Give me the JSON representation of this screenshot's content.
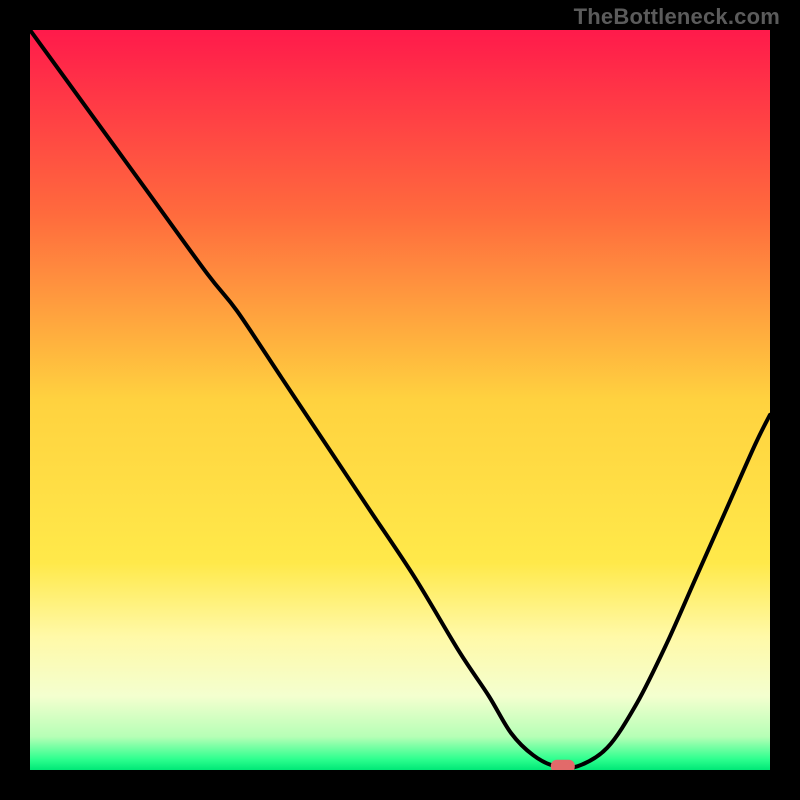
{
  "watermark": "TheBottleneck.com",
  "chart_data": {
    "type": "line",
    "title": "",
    "xlabel": "",
    "ylabel": "",
    "xlim": [
      0,
      100
    ],
    "ylim": [
      0,
      100
    ],
    "grid": false,
    "legend": false,
    "background_gradient": {
      "stops": [
        {
          "pos": 0.0,
          "color": "#ff1a4b"
        },
        {
          "pos": 0.25,
          "color": "#ff6b3d"
        },
        {
          "pos": 0.5,
          "color": "#ffd23f"
        },
        {
          "pos": 0.72,
          "color": "#ffe94a"
        },
        {
          "pos": 0.82,
          "color": "#fff9a8"
        },
        {
          "pos": 0.9,
          "color": "#f4ffcf"
        },
        {
          "pos": 0.955,
          "color": "#b6ffb6"
        },
        {
          "pos": 0.985,
          "color": "#2fff8f"
        },
        {
          "pos": 1.0,
          "color": "#00e877"
        }
      ]
    },
    "series": [
      {
        "name": "bottleneck-curve",
        "color": "#000000",
        "x": [
          0,
          8,
          16,
          24,
          28,
          34,
          40,
          46,
          52,
          58,
          62,
          65,
          68,
          71,
          74,
          78,
          82,
          86,
          90,
          94,
          98,
          100
        ],
        "y": [
          100,
          89,
          78,
          67,
          62,
          53,
          44,
          35,
          26,
          16,
          10,
          5,
          2,
          0.5,
          0.5,
          3,
          9,
          17,
          26,
          35,
          44,
          48
        ]
      }
    ],
    "marker": {
      "name": "optimal-point",
      "x": 72,
      "y": 0.5,
      "color": "#e26a6a",
      "shape": "rounded-rect"
    }
  }
}
